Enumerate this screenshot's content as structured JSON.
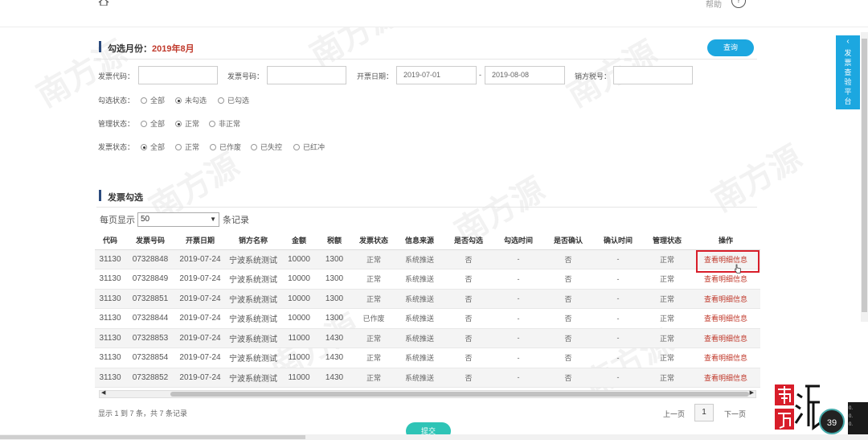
{
  "header": {
    "help_label": "帮助",
    "help_icon": "question-circle-icon"
  },
  "filter": {
    "title_prefix": "勾选月份：",
    "month": "2019年8月",
    "query_label": "查询",
    "invoice_code_label": "发票代码：",
    "invoice_code_value": "",
    "invoice_no_label": "发票号码：",
    "invoice_no_value": "",
    "issue_date_label": "开票日期：",
    "date_from": "2019-07-01",
    "date_to": "2019-08-08",
    "date_sep": "-",
    "seller_tax_label": "销方税号：",
    "seller_tax_value": "",
    "check_status": {
      "label": "勾选状态：",
      "options": [
        "全部",
        "未勾选",
        "已勾选"
      ],
      "selected": 1
    },
    "manage_status": {
      "label": "管理状态：",
      "options": [
        "全部",
        "正常",
        "非正常"
      ],
      "selected": 1
    },
    "invoice_status": {
      "label": "发票状态：",
      "options": [
        "全部",
        "正常",
        "已作废",
        "已失控",
        "已红冲"
      ],
      "selected": 0
    }
  },
  "list": {
    "title": "发票勾选",
    "per_page_label": "每页显示",
    "per_page_value": "50",
    "per_page_suffix": "条记录",
    "columns": [
      "代码",
      "发票号码",
      "开票日期",
      "销方名称",
      "金额",
      "税额",
      "发票状态",
      "信息来源",
      "是否勾选",
      "勾选时间",
      "是否确认",
      "确认时间",
      "管理状态",
      "操作"
    ],
    "rows": [
      [
        "31130",
        "07328848",
        "2019-07-24",
        "宁波系统测试",
        "10000",
        "1300",
        "正常",
        "系统推送",
        "否",
        "-",
        "否",
        "-",
        "正常",
        "查看明细信息"
      ],
      [
        "31130",
        "07328849",
        "2019-07-24",
        "宁波系统测试",
        "10000",
        "1300",
        "正常",
        "系统推送",
        "否",
        "-",
        "否",
        "-",
        "正常",
        "查看明细信息"
      ],
      [
        "31130",
        "07328851",
        "2019-07-24",
        "宁波系统测试",
        "10000",
        "1300",
        "正常",
        "系统推送",
        "否",
        "-",
        "否",
        "-",
        "正常",
        "查看明细信息"
      ],
      [
        "31130",
        "07328844",
        "2019-07-24",
        "宁波系统测试",
        "10000",
        "1300",
        "已作废",
        "系统推送",
        "否",
        "-",
        "否",
        "-",
        "正常",
        "查看明细信息"
      ],
      [
        "31130",
        "07328853",
        "2019-07-24",
        "宁波系统测试",
        "11000",
        "1430",
        "正常",
        "系统推送",
        "否",
        "-",
        "否",
        "-",
        "正常",
        "查看明细信息"
      ],
      [
        "31130",
        "07328854",
        "2019-07-24",
        "宁波系统测试",
        "11000",
        "1430",
        "正常",
        "系统推送",
        "否",
        "-",
        "否",
        "-",
        "正常",
        "查看明细信息"
      ],
      [
        "31130",
        "07328852",
        "2019-07-24",
        "宁波系统测试",
        "11000",
        "1430",
        "正常",
        "系统推送",
        "否",
        "-",
        "否",
        "-",
        "正常",
        "查看明细信息"
      ]
    ],
    "summary": "显示 1 到 7 条，共 7 条记录",
    "prev_label": "上一页",
    "current_page": "1",
    "next_label": "下一页"
  },
  "submit_label": "提交",
  "side_tab": {
    "label": "发票查验平台"
  },
  "watermark": "南方源",
  "badge_value": "39",
  "mini_panel": [
    "0.",
    "0.",
    "0."
  ],
  "colors": {
    "accent": "#1ca7e0",
    "link": "#c0392b",
    "highlight": "#d81e2a",
    "submit": "#2ec4b6"
  }
}
